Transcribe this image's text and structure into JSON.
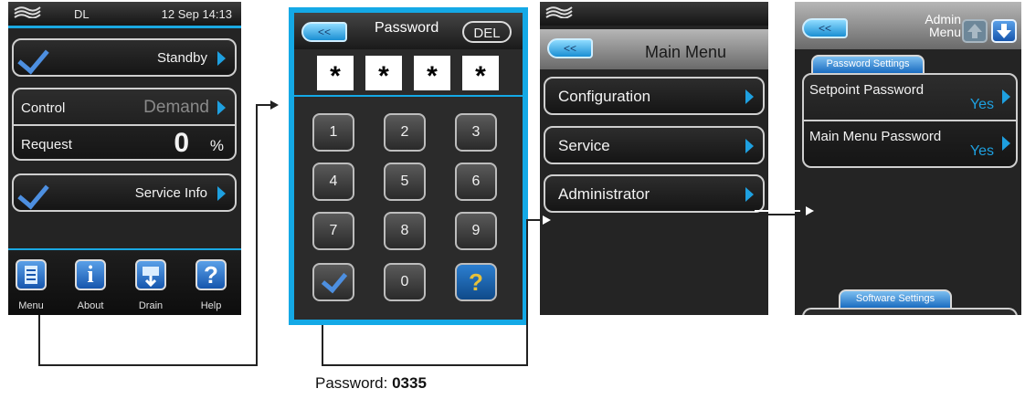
{
  "screen1": {
    "status": {
      "user": "DL",
      "datetime": "12 Sep 14:13"
    },
    "standby_label": "Standby",
    "control_label": "Control",
    "control_value": "Demand",
    "request_label": "Request",
    "request_value": "0",
    "request_unit": "%",
    "service_info_label": "Service Info",
    "toolbar": {
      "menu": "Menu",
      "about": "About",
      "drain": "Drain",
      "help": "Help"
    }
  },
  "screen2": {
    "back_label": "<<",
    "title": "Password",
    "del_label": "DEL",
    "fields": [
      "*",
      "*",
      "*",
      "*"
    ],
    "keys": [
      "1",
      "2",
      "3",
      "4",
      "5",
      "6",
      "7",
      "8",
      "9",
      "0"
    ]
  },
  "screen3": {
    "back_label": "<<",
    "title": "Main Menu",
    "items": [
      "Configuration",
      "Service",
      "Administrator"
    ]
  },
  "screen4": {
    "back_label": "<<",
    "title": "Admin Menu",
    "password_tab": "Password Settings",
    "setpoint_label": "Setpoint Password",
    "setpoint_value": "Yes",
    "mainmenu_label": "Main Menu Password",
    "mainmenu_value": "Yes",
    "software_tab": "Software Settings"
  },
  "caption": {
    "prefix": "Password: ",
    "value": "0335"
  },
  "colors": {
    "accent": "#1aa8e2",
    "screen_bg": "#242424",
    "chevron": "#1ea0e0"
  }
}
